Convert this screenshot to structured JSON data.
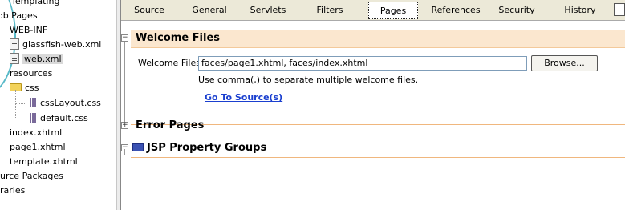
{
  "tree": {
    "items": [
      {
        "label": "Templating",
        "icon": ""
      },
      {
        "label": ":b Pages",
        "icon": ""
      },
      {
        "label": "WEB-INF",
        "icon": ""
      },
      {
        "label": "glassfish-web.xml",
        "icon": "xml-file-icon"
      },
      {
        "label": "web.xml",
        "icon": "xml-file-icon",
        "selected": true
      },
      {
        "label": "resources",
        "icon": ""
      },
      {
        "label": "css",
        "icon": "folder-icon"
      },
      {
        "label": "cssLayout.css",
        "icon": "css-file-icon"
      },
      {
        "label": "default.css",
        "icon": "css-file-icon"
      },
      {
        "label": "index.xhtml",
        "icon": ""
      },
      {
        "label": "page1.xhtml",
        "icon": ""
      },
      {
        "label": "template.xhtml",
        "icon": ""
      },
      {
        "label": "urce Packages",
        "icon": ""
      },
      {
        "label": "raries",
        "icon": ""
      }
    ]
  },
  "tabs": [
    "Source",
    "General",
    "Servlets",
    "Filters",
    "Pages",
    "References",
    "Security",
    "History"
  ],
  "active_tab": "Pages",
  "welcome": {
    "title": "Welcome Files",
    "toggle": "−",
    "field_label": "Welcome Files:",
    "field_value": "faces/page1.xhtml, faces/index.xhtml",
    "browse_label": "Browse...",
    "help": "Use comma(,) to separate multiple welcome files.",
    "link": "Go To Source(s)"
  },
  "errors": {
    "title": "Error Pages",
    "toggle": "+"
  },
  "jsp": {
    "title": "JSP Property Groups",
    "toggle": "−"
  },
  "colors": {
    "section_bar": "#fbe7cf",
    "divider": "#f0b77e",
    "link": "#1a3fcf",
    "tab_strip": "#ece9d8"
  }
}
